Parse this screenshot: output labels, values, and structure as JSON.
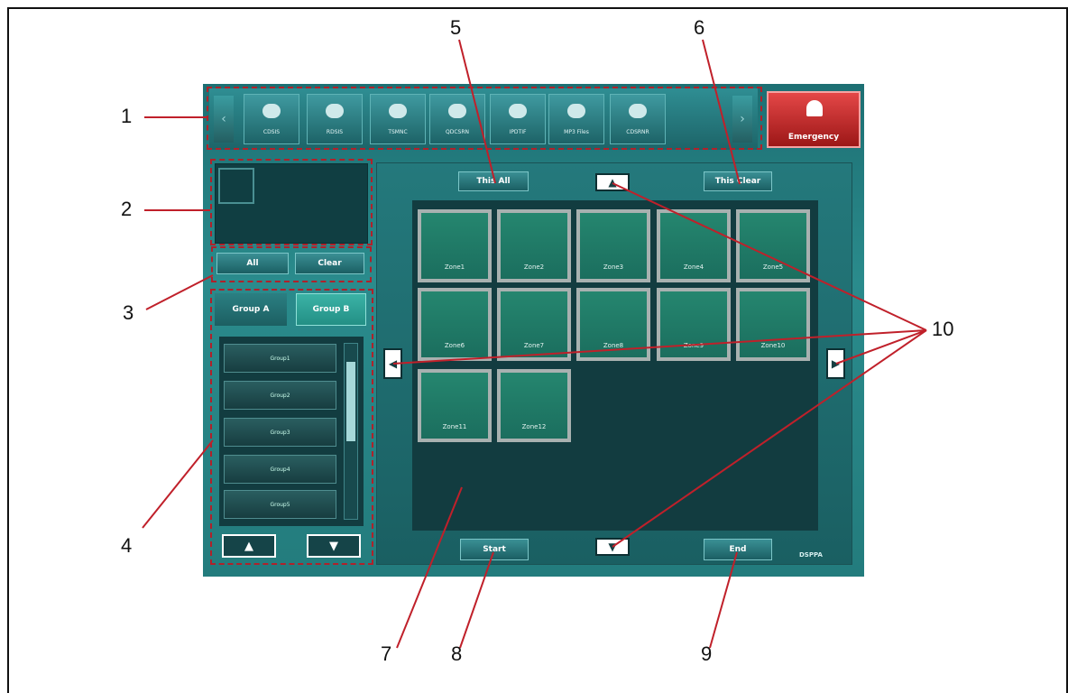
{
  "toolbar": {
    "scroll_left": "‹",
    "scroll_right": "›",
    "items": [
      {
        "label": "CDSIS"
      },
      {
        "label": "RDSIS"
      },
      {
        "label": "TSMNC"
      },
      {
        "label": "QDCSRN"
      },
      {
        "label": "IPDTIF"
      },
      {
        "label": "MP3 Files"
      },
      {
        "label": "CDSRNR"
      }
    ],
    "emergency_label": "Emergency"
  },
  "left_panel": {
    "all_label": "All",
    "clear_label": "Clear",
    "tabs": [
      {
        "label": "Group A"
      },
      {
        "label": "Group B"
      }
    ],
    "groups": [
      {
        "label": "Group1"
      },
      {
        "label": "Group2"
      },
      {
        "label": "Group3"
      },
      {
        "label": "Group4"
      },
      {
        "label": "Group5"
      }
    ]
  },
  "main": {
    "this_all_label": "This All",
    "this_clear_label": "This Clear",
    "start_label": "Start",
    "end_label": "End",
    "logo_text": "DSPPA",
    "zones": [
      {
        "label": "Zone1"
      },
      {
        "label": "Zone2"
      },
      {
        "label": "Zone3"
      },
      {
        "label": "Zone4"
      },
      {
        "label": "Zone5"
      },
      {
        "label": "Zone6"
      },
      {
        "label": "Zone7"
      },
      {
        "label": "Zone8"
      },
      {
        "label": "Zone9"
      },
      {
        "label": "Zone10"
      },
      {
        "label": "Zone11"
      },
      {
        "label": "Zone12"
      }
    ]
  },
  "callouts": [
    "1",
    "2",
    "3",
    "4",
    "5",
    "6",
    "7",
    "8",
    "9",
    "10"
  ],
  "colors": {
    "accent_teal": "#2a8b8c",
    "emergency_red": "#c22828",
    "callout_red": "#c0202a"
  }
}
